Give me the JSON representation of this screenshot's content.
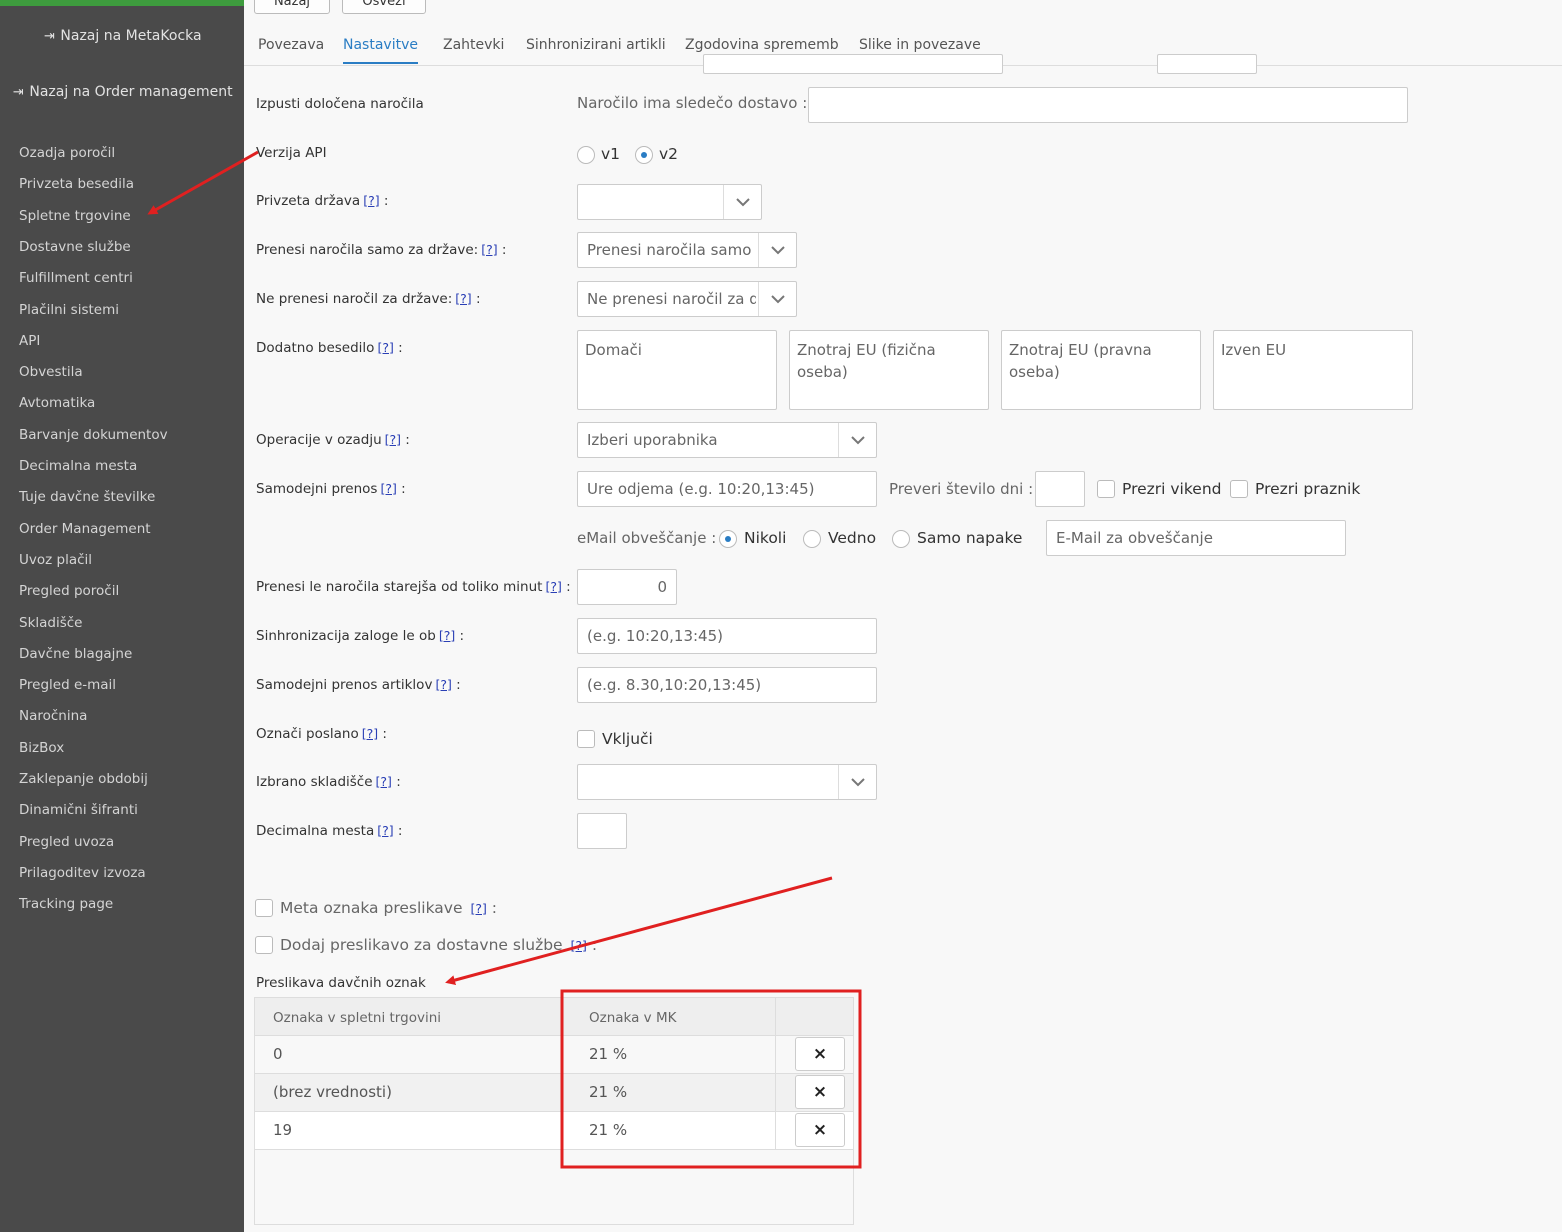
{
  "sidebar": {
    "back_metakocka": "Nazaj na MetaKocka",
    "back_order_mgmt": "Nazaj na Order management",
    "items": [
      "Ozadja poročil",
      "Privzeta besedila",
      "Spletne trgovine",
      "Dostavne službe",
      "Fulfillment centri",
      "Plačilni sistemi",
      "API",
      "Obvestila",
      "Avtomatika",
      "Barvanje dokumentov",
      "Decimalna mesta",
      "Tuje davčne številke",
      "Order Management",
      "Uvoz plačil",
      "Pregled poročil",
      "Skladišče",
      "Davčne blagajne",
      "Pregled e-mail",
      "Naročnina",
      "BizBox",
      "Zaklepanje obdobij",
      "Dinamični šifranti",
      "Pregled uvoza",
      "Prilagoditev izvoza",
      "Tracking page"
    ]
  },
  "top_buttons": {
    "back": "Nazaj",
    "refresh": "Osveži"
  },
  "tabs": [
    "Povezava",
    "Nastavitve",
    "Zahtevki",
    "Sinhronizirani artikli",
    "Zgodovina sprememb",
    "Slike in povezave"
  ],
  "help": "[?]",
  "form": {
    "skip_orders": {
      "label": "Izpusti določena naročila",
      "sub_label": "Naročilo ima sledečo dostavo :",
      "value": ""
    },
    "api_version": {
      "label": "Verzija API",
      "options": [
        "v1",
        "v2"
      ],
      "selected": "v2"
    },
    "default_country": {
      "label": "Privzeta država",
      "value": ""
    },
    "only_countries": {
      "label": "Prenesi naročila samo za države:",
      "placeholder": "Prenesi naročila samo za države"
    },
    "not_countries": {
      "label": "Ne prenesi naročil za države:",
      "placeholder": "Ne prenesi naročil za države"
    },
    "extra_text": {
      "label": "Dodatno besedilo",
      "fields": [
        "Domači",
        "Znotraj EU (fizična oseba)",
        "Znotraj EU (pravna oseba)",
        "Izven EU"
      ]
    },
    "background_ops": {
      "label": "Operacije v ozadju",
      "value": "Izberi uporabnika"
    },
    "auto_transfer": {
      "label": "Samodejni prenos",
      "placeholder": "Ure odjema (e.g. 10:20,13:45)",
      "check_days_label": "Preveri število dni :",
      "ignore_weekend": "Prezri vikend",
      "ignore_holiday": "Prezri praznik",
      "email_label": "eMail obveščanje :",
      "email_options": [
        "Nikoli",
        "Vedno",
        "Samo napake"
      ],
      "email_selected": "Nikoli",
      "email_placeholder": "E-Mail za obveščanje"
    },
    "older_than": {
      "label": "Prenesi le naročila starejša od toliko minut",
      "value": "0"
    },
    "stock_sync": {
      "label": "Sinhronizacija zaloge le ob",
      "placeholder": "(e.g. 10:20,13:45)"
    },
    "auto_articles": {
      "label": "Samodejni prenos artiklov",
      "placeholder": "(e.g. 8.30,10:20,13:45)"
    },
    "mark_sent": {
      "label": "Označi poslano",
      "checkbox": "Vključi"
    },
    "warehouse": {
      "label": "Izbrano skladišče",
      "value": ""
    },
    "decimals": {
      "label": "Decimalna mesta",
      "value": ""
    },
    "meta_mapping": {
      "label": "Meta oznaka preslikave"
    },
    "delivery_mapping": {
      "label": "Dodaj preslikavo za dostavne službe"
    }
  },
  "tax_mapping": {
    "title": "Preslikava davčnih oznak",
    "headers": [
      "Oznaka v spletni trgovini",
      "Oznaka v MK"
    ],
    "delete_symbol": "×",
    "rows": [
      {
        "shop": "0",
        "mk": "21 %"
      },
      {
        "shop": "(brez vrednosti)",
        "mk": "21 %"
      },
      {
        "shop": "19",
        "mk": "21 %"
      }
    ]
  },
  "colors": {
    "sidebar": "#4a4a4a",
    "accent": "#2a7dc4",
    "annotation": "#e02020",
    "green": "#3e9c3e"
  }
}
